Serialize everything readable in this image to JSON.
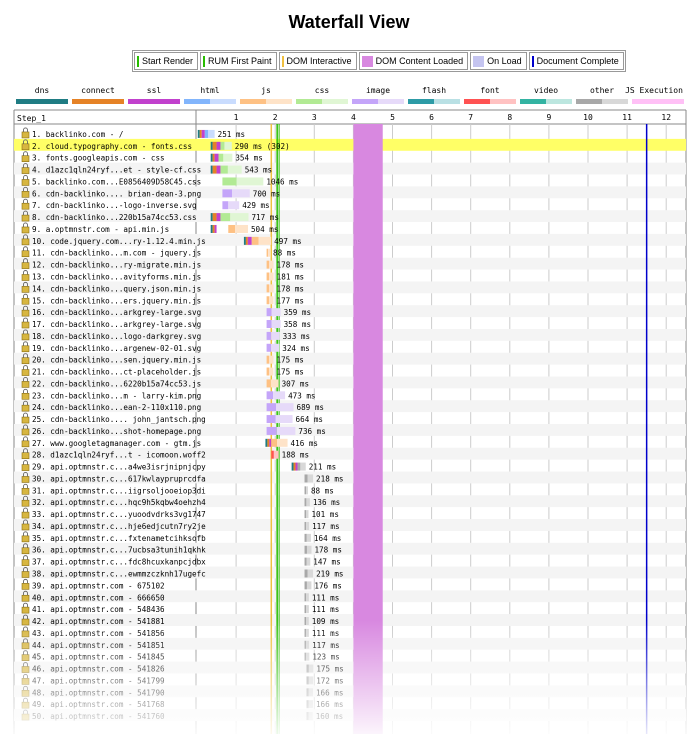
{
  "page": {
    "title": "Waterfall View"
  },
  "legend": [
    {
      "label": "Start Render",
      "color": "#28bc00",
      "kind": "line"
    },
    {
      "label": "RUM First Paint",
      "color": "#28bc00",
      "kind": "line"
    },
    {
      "label": "DOM Interactive",
      "color": "#f0c040",
      "kind": "line"
    },
    {
      "label": "DOM Content Loaded",
      "color": "#d888e0",
      "kind": "block"
    },
    {
      "label": "On Load",
      "color": "#c4c4f0",
      "kind": "block"
    },
    {
      "label": "Document Complete",
      "color": "#0000cc",
      "kind": "line"
    }
  ],
  "types": [
    {
      "label": "dns",
      "c1": "#1f7c83",
      "c2": "#1f7c83"
    },
    {
      "label": "connect",
      "c1": "#e58226",
      "c2": "#e58226"
    },
    {
      "label": "ssl",
      "c1": "#c141cd",
      "c2": "#c141cd"
    },
    {
      "label": "html",
      "c1": "#82b5fc",
      "c2": "#c9dcfe"
    },
    {
      "label": "js",
      "c1": "#fec184",
      "c2": "#fee3c8"
    },
    {
      "label": "css",
      "c1": "#b2ea94",
      "c2": "#e0f6d4"
    },
    {
      "label": "image",
      "c1": "#c4a5f9",
      "c2": "#e6daf9"
    },
    {
      "label": "flash",
      "c1": "#2d9ba6",
      "c2": "#b9e0e4"
    },
    {
      "label": "font",
      "c1": "#ff5252",
      "c2": "#ffc2c2"
    },
    {
      "label": "video",
      "c1": "#33b3a2",
      "c2": "#bce6df"
    },
    {
      "label": "other",
      "c1": "#a8a8a8",
      "c2": "#d8d8d8"
    },
    {
      "label": "JS Execution",
      "c1": "#ffc0f6",
      "c2": "#ffc0f6"
    }
  ],
  "chart_data": {
    "type": "waterfall",
    "step_label": "Step_1",
    "x_ticks": [
      1,
      2,
      3,
      4,
      5,
      6,
      7,
      8,
      9,
      10,
      11,
      12
    ],
    "x_unit": "s",
    "markers": {
      "start_render": 2.05,
      "rum_first_paint": 2.1,
      "dom_interactive": 1.9,
      "dom_content_loaded": [
        4.0,
        4.75
      ],
      "document_complete": 11.5
    },
    "requests": [
      {
        "n": 1,
        "label": "1. backlinko.com - /",
        "type": "html",
        "start": 0.02,
        "dns": 0.05,
        "connect": 0.05,
        "ssl": 0.08,
        "dur": 0.251,
        "text": "251 ms",
        "lock": true
      },
      {
        "n": 2,
        "label": "2. cloud.typography.com - fonts.css",
        "type": "css",
        "start": 0.35,
        "dns": 0.05,
        "connect": 0.1,
        "ssl": 0.1,
        "dur": 0.29,
        "text": "290 ms (302)",
        "lock": true,
        "highlight": true
      },
      {
        "n": 3,
        "label": "3. fonts.googleapis.com - css",
        "type": "css",
        "start": 0.35,
        "dns": 0.05,
        "connect": 0.05,
        "ssl": 0.1,
        "dur": 0.354,
        "text": "354 ms",
        "lock": true
      },
      {
        "n": 4,
        "label": "4. d1azc1qln24ryf...et - style-cf.css",
        "type": "css",
        "start": 0.35,
        "dns": 0.05,
        "connect": 0.1,
        "ssl": 0.1,
        "dur": 0.543,
        "text": "543 ms",
        "lock": true
      },
      {
        "n": 5,
        "label": "5. backlinko.com...E0856409D58C45.css",
        "type": "css",
        "start": 0.65,
        "dur": 1.046,
        "text": "1046 ms",
        "lock": true
      },
      {
        "n": 6,
        "label": "6. cdn-backlinko.... brian-dean-3.png",
        "type": "image",
        "start": 0.65,
        "dur": 0.7,
        "text": "700 ms",
        "lock": true
      },
      {
        "n": 7,
        "label": "7. cdn-backlinko...-logo-inverse.svg",
        "type": "image",
        "start": 0.65,
        "dur": 0.429,
        "text": "429 ms",
        "lock": true
      },
      {
        "n": 8,
        "label": "8. cdn-backlinko...220b15a74cc53.css",
        "type": "css",
        "start": 0.35,
        "dns": 0.05,
        "connect": 0.1,
        "ssl": 0.1,
        "dur": 0.717,
        "text": "717 ms",
        "lock": true
      },
      {
        "n": 9,
        "label": "9. a.optmnstr.com - api.min.js",
        "type": "js",
        "start": 0.35,
        "dns": 0.05,
        "connect": 0.05,
        "ssl": 0.05,
        "dur": 0.504,
        "text": "504 ms",
        "lock": true,
        "gap": true
      },
      {
        "n": 10,
        "label": "10. code.jquery.com...ry-1.12.4.min.js",
        "type": "js",
        "start": 1.2,
        "dns": 0.05,
        "connect": 0.05,
        "ssl": 0.1,
        "dur": 0.497,
        "text": "497 ms",
        "lock": true
      },
      {
        "n": 11,
        "label": "11. cdn-backlinko...m.com - jquery.js",
        "type": "js",
        "start": 1.78,
        "dur": 0.088,
        "text": "88 ms",
        "lock": true
      },
      {
        "n": 12,
        "label": "12. cdn-backlinko...ry-migrate.min.js",
        "type": "js",
        "start": 1.78,
        "dur": 0.178,
        "text": "178 ms",
        "lock": true
      },
      {
        "n": 13,
        "label": "13. cdn-backlinko...avityforms.min.js",
        "type": "js",
        "start": 1.78,
        "dur": 0.181,
        "text": "181 ms",
        "lock": true
      },
      {
        "n": 14,
        "label": "14. cdn-backlinko...query.json.min.js",
        "type": "js",
        "start": 1.78,
        "dur": 0.178,
        "text": "178 ms",
        "lock": true
      },
      {
        "n": 15,
        "label": "15. cdn-backlinko...ers.jquery.min.js",
        "type": "js",
        "start": 1.78,
        "dur": 0.177,
        "text": "177 ms",
        "lock": true
      },
      {
        "n": 16,
        "label": "16. cdn-backlinko...arkgrey-large.svg",
        "type": "image",
        "start": 1.78,
        "dur": 0.359,
        "text": "359 ms",
        "lock": true
      },
      {
        "n": 17,
        "label": "17. cdn-backlinko...arkgrey-large.svg",
        "type": "image",
        "start": 1.78,
        "dur": 0.358,
        "text": "358 ms",
        "lock": true
      },
      {
        "n": 18,
        "label": "18. cdn-backlinko...logo-darkgrey.svg",
        "type": "image",
        "start": 1.78,
        "dur": 0.333,
        "text": "333 ms",
        "lock": true
      },
      {
        "n": 19,
        "label": "19. cdn-backlinko...argenew-02-01.svg",
        "type": "image",
        "start": 1.78,
        "dur": 0.324,
        "text": "324 ms",
        "lock": true
      },
      {
        "n": 20,
        "label": "20. cdn-backlinko...sen.jquery.min.js",
        "type": "js",
        "start": 1.78,
        "dur": 0.175,
        "text": "175 ms",
        "lock": true
      },
      {
        "n": 21,
        "label": "21. cdn-backlinko...ct-placeholder.js",
        "type": "js",
        "start": 1.78,
        "dur": 0.175,
        "text": "175 ms",
        "lock": true
      },
      {
        "n": 22,
        "label": "22. cdn-backlinko...6220b15a74cc53.js",
        "type": "js",
        "start": 1.78,
        "dur": 0.307,
        "text": "307 ms",
        "lock": true
      },
      {
        "n": 23,
        "label": "23. cdn-backlinko...m - larry-kim.png",
        "type": "image",
        "start": 1.78,
        "dur": 0.473,
        "text": "473 ms",
        "lock": true
      },
      {
        "n": 24,
        "label": "24. cdn-backlinko...ean-2-110x110.png",
        "type": "image",
        "start": 1.78,
        "dur": 0.689,
        "text": "689 ms",
        "lock": true
      },
      {
        "n": 25,
        "label": "25. cdn-backlinko.... john_jantsch.png",
        "type": "image",
        "start": 1.78,
        "dur": 0.664,
        "text": "664 ms",
        "lock": true
      },
      {
        "n": 26,
        "label": "26. cdn-backlinko...shot-homepage.png",
        "type": "image",
        "start": 1.78,
        "dur": 0.736,
        "text": "736 ms",
        "lock": true
      },
      {
        "n": 27,
        "label": "27. www.googletagmanager.com - gtm.js",
        "type": "js",
        "start": 1.75,
        "dns": 0.05,
        "connect": 0.05,
        "ssl": 0.05,
        "dur": 0.416,
        "text": "416 ms",
        "lock": true
      },
      {
        "n": 28,
        "label": "28. d1azc1qln24ryf...t - icomoon.woff2",
        "type": "font",
        "start": 1.9,
        "dur": 0.188,
        "text": "188 ms",
        "lock": true
      },
      {
        "n": 29,
        "label": "29. api.optmnstr.c...a4we3isrjnipnjcpy",
        "type": "other",
        "start": 2.42,
        "dns": 0.05,
        "connect": 0.05,
        "ssl": 0.05,
        "dur": 0.211,
        "text": "211 ms",
        "lock": true
      },
      {
        "n": 30,
        "label": "30. api.optmnstr.c...617kwlaypruprcdfa",
        "type": "other",
        "start": 2.75,
        "dur": 0.218,
        "text": "218 ms",
        "lock": true
      },
      {
        "n": 31,
        "label": "31. api.optmnstr.c...iigrsoljooeiop3di",
        "type": "other",
        "start": 2.75,
        "dur": 0.088,
        "text": "88 ms",
        "lock": true
      },
      {
        "n": 32,
        "label": "32. api.optmnstr.c...hqc9h5kqbw4oehzh4",
        "type": "other",
        "start": 2.75,
        "dur": 0.136,
        "text": "136 ms",
        "lock": true
      },
      {
        "n": 33,
        "label": "33. api.optmnstr.c...yuoodvdrks3vg1747",
        "type": "other",
        "start": 2.75,
        "dur": 0.101,
        "text": "101 ms",
        "lock": true
      },
      {
        "n": 34,
        "label": "34. api.optmnstr.c...hje6edjcutn7ry2je",
        "type": "other",
        "start": 2.75,
        "dur": 0.117,
        "text": "117 ms",
        "lock": true
      },
      {
        "n": 35,
        "label": "35. api.optmnstr.c...fxtenametcihksofb",
        "type": "other",
        "start": 2.75,
        "dur": 0.164,
        "text": "164 ms",
        "lock": true
      },
      {
        "n": 36,
        "label": "36. api.optmnstr.c...7ucbsa3tunih1qkhk",
        "type": "other",
        "start": 2.75,
        "dur": 0.178,
        "text": "178 ms",
        "lock": true
      },
      {
        "n": 37,
        "label": "37. api.optmnstr.c...fdc8hcuxkanpcjdbx",
        "type": "other",
        "start": 2.75,
        "dur": 0.147,
        "text": "147 ms",
        "lock": true
      },
      {
        "n": 38,
        "label": "38. api.optmnstr.c...ewmmzczknh17ugefc",
        "type": "other",
        "start": 2.75,
        "dur": 0.219,
        "text": "219 ms",
        "lock": true
      },
      {
        "n": 39,
        "label": "39. api.optmnstr.com - 675102",
        "type": "other",
        "start": 2.75,
        "dur": 0.176,
        "text": "176 ms",
        "lock": true
      },
      {
        "n": 40,
        "label": "40. api.optmnstr.com - 666650",
        "type": "other",
        "start": 2.75,
        "dur": 0.111,
        "text": "111 ms",
        "lock": true
      },
      {
        "n": 41,
        "label": "41. api.optmnstr.com - 548436",
        "type": "other",
        "start": 2.75,
        "dur": 0.111,
        "text": "111 ms",
        "lock": true
      },
      {
        "n": 42,
        "label": "42. api.optmnstr.com - 541881",
        "type": "other",
        "start": 2.75,
        "dur": 0.109,
        "text": "109 ms",
        "lock": true
      },
      {
        "n": 43,
        "label": "43. api.optmnstr.com - 541856",
        "type": "other",
        "start": 2.75,
        "dur": 0.111,
        "text": "111 ms",
        "lock": true
      },
      {
        "n": 44,
        "label": "44. api.optmnstr.com - 541851",
        "type": "other",
        "start": 2.75,
        "dur": 0.117,
        "text": "117 ms",
        "lock": true
      },
      {
        "n": 45,
        "label": "45. api.optmnstr.com - 541845",
        "type": "other",
        "start": 2.75,
        "dur": 0.123,
        "text": "123 ms",
        "lock": true
      },
      {
        "n": 46,
        "label": "46. api.optmnstr.com - 541826",
        "type": "other",
        "start": 2.8,
        "dur": 0.175,
        "text": "175 ms",
        "lock": true
      },
      {
        "n": 47,
        "label": "47. api.optmnstr.com - 541799",
        "type": "other",
        "start": 2.8,
        "dur": 0.172,
        "text": "172 ms",
        "lock": true
      },
      {
        "n": 48,
        "label": "48. api.optmnstr.com - 541790",
        "type": "other",
        "start": 2.8,
        "dur": 0.166,
        "text": "166 ms",
        "lock": true
      },
      {
        "n": 49,
        "label": "49. api.optmnstr.com - 541768",
        "type": "other",
        "start": 2.8,
        "dur": 0.166,
        "text": "166 ms",
        "lock": true
      },
      {
        "n": 50,
        "label": "50. api.optmnstr.com - 541760",
        "type": "other",
        "start": 2.8,
        "dur": 0.16,
        "text": "160 ms",
        "lock": true
      }
    ]
  }
}
